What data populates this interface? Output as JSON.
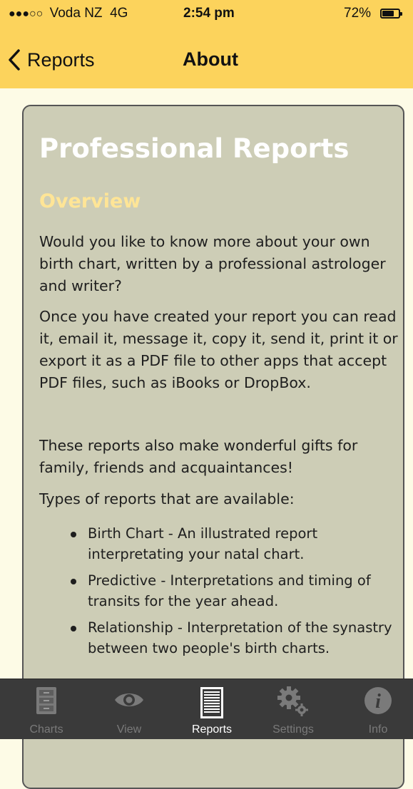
{
  "status_bar": {
    "signal_dots": "●●●○○",
    "carrier": "Voda NZ",
    "network": "4G",
    "time": "2:54 pm",
    "battery_percent": "72%",
    "battery_level": 0.72
  },
  "nav": {
    "back_label": "Reports",
    "title": "About",
    "background_color": "#fcd35c"
  },
  "content": {
    "title": "Professional Reports",
    "section_heading": "Overview",
    "paragraphs": [
      "Would you like to know more about your own birth chart, written by a professional astrologer and writer?",
      "Once you have created your report you can read it, email it, message it, copy it, send it, print it or export it as a PDF file to other apps that accept PDF files, such as iBooks or DropBox.",
      "These reports also make wonderful gifts for family, friends and acquaintances!",
      "Types of reports that are available:"
    ],
    "report_types": [
      "Birth Chart - An illustrated report interpretating your natal chart.",
      "Predictive - Interpretations and timing of transits for the year ahead.",
      "Relationship - Interpretation of the synastry between two people's birth charts."
    ]
  },
  "tab_bar": {
    "tabs": [
      {
        "label": "Charts",
        "icon": "file-cabinet-icon",
        "active": false
      },
      {
        "label": "View",
        "icon": "eye-icon",
        "active": false
      },
      {
        "label": "Reports",
        "icon": "document-icon",
        "active": true
      },
      {
        "label": "Settings",
        "icon": "gears-icon",
        "active": false
      },
      {
        "label": "Info",
        "icon": "info-icon",
        "active": false
      }
    ]
  }
}
